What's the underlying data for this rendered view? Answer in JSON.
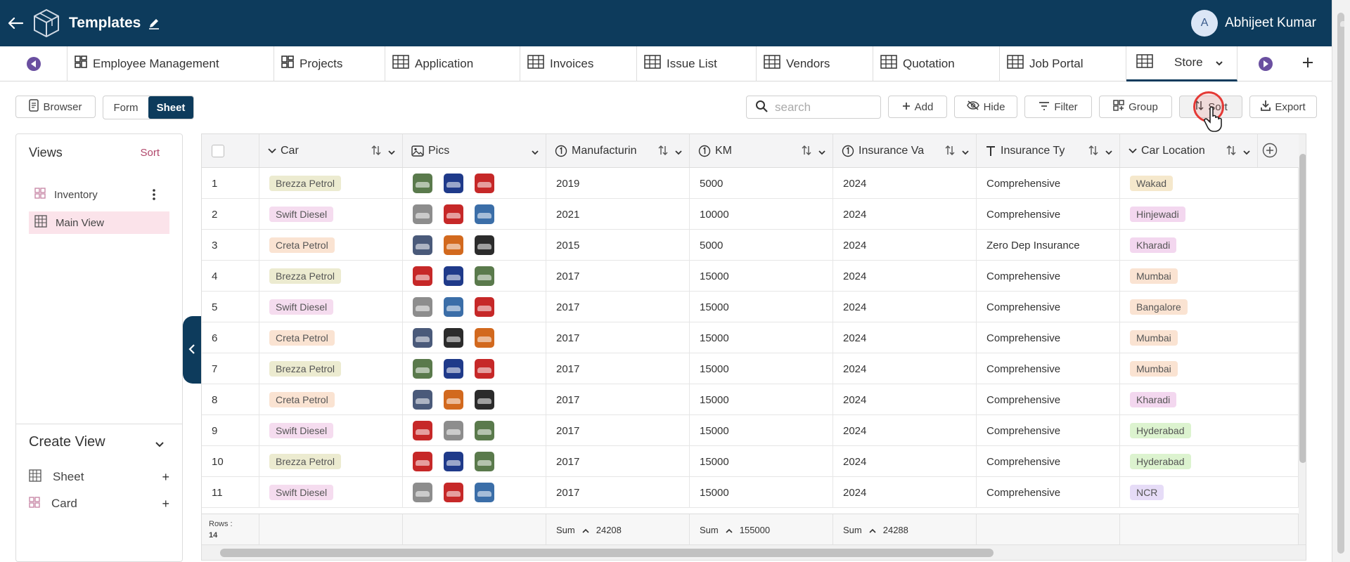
{
  "header": {
    "title": "Templates",
    "user": {
      "initial": "A",
      "name": "Abhijeet Kumar"
    }
  },
  "tabs": [
    {
      "label": "Employee Management",
      "icon": "dashboard-icon"
    },
    {
      "label": "Projects",
      "icon": "dashboard-icon"
    },
    {
      "label": "Application",
      "icon": "table-icon"
    },
    {
      "label": "Invoices",
      "icon": "table-icon"
    },
    {
      "label": "Issue List",
      "icon": "table-icon"
    },
    {
      "label": "Vendors",
      "icon": "table-icon"
    },
    {
      "label": "Quotation",
      "icon": "table-icon"
    },
    {
      "label": "Job Portal",
      "icon": "table-icon"
    },
    {
      "label": "Store",
      "icon": "table-icon",
      "active": true
    }
  ],
  "toolbar": {
    "browser": "Browser",
    "form": "Form",
    "sheet": "Sheet",
    "search_placeholder": "search",
    "add": "Add",
    "hide": "Hide",
    "filter": "Filter",
    "group": "Group",
    "sort": "Sort",
    "export": "Export"
  },
  "views": {
    "title": "Views",
    "sort": "Sort",
    "items": [
      {
        "label": "Inventory"
      },
      {
        "label": "Main View",
        "selected": true
      }
    ],
    "create_title": "Create View",
    "create_items": [
      {
        "label": "Sheet"
      },
      {
        "label": "Card"
      }
    ]
  },
  "columns": [
    "Car",
    "Pics",
    "Manufacturin",
    "KM",
    "Insurance Va",
    "Insurance Ty",
    "Car Location"
  ],
  "tag_colors": {
    "Brezza Petrol": "#ecebd0",
    "Swift Diesel": "#f5dcef",
    "Creta Petrol": "#fae3d2",
    "Wakad": "#f5e8cc",
    "Hinjewadi": "#f3d7ef",
    "Kharadi": "#f3d7ef",
    "Mumbai": "#fae3d2",
    "Bangalore": "#fae3d2",
    "Hyderabad": "#dcf3cf",
    "NCR": "#e6dcf7"
  },
  "rows": [
    {
      "id": "1",
      "car": "Brezza Petrol",
      "pics": [
        "#5a7a4c",
        "#1f3a8a",
        "#c62828"
      ],
      "year": "2019",
      "km": "5000",
      "ins_val": "2024",
      "ins_type": "Comprehensive",
      "location": "Wakad"
    },
    {
      "id": "2",
      "car": "Swift Diesel",
      "pics": [
        "#8d8d8d",
        "#c62828",
        "#3b6ea8"
      ],
      "year": "2021",
      "km": "10000",
      "ins_val": "2024",
      "ins_type": "Comprehensive",
      "location": "Hinjewadi"
    },
    {
      "id": "3",
      "car": "Creta Petrol",
      "pics": [
        "#4a5a7a",
        "#d2691e",
        "#2b2b2b"
      ],
      "year": "2015",
      "km": "5000",
      "ins_val": "2024",
      "ins_type": "Zero Dep Insurance",
      "location": "Kharadi"
    },
    {
      "id": "4",
      "car": "Brezza Petrol",
      "pics": [
        "#c62828",
        "#1f3a8a",
        "#5a7a4c"
      ],
      "year": "2017",
      "km": "15000",
      "ins_val": "2024",
      "ins_type": "Comprehensive",
      "location": "Mumbai"
    },
    {
      "id": "5",
      "car": "Swift Diesel",
      "pics": [
        "#8d8d8d",
        "#3b6ea8",
        "#c62828"
      ],
      "year": "2017",
      "km": "15000",
      "ins_val": "2024",
      "ins_type": "Comprehensive",
      "location": "Bangalore"
    },
    {
      "id": "6",
      "car": "Creta Petrol",
      "pics": [
        "#4a5a7a",
        "#2b2b2b",
        "#d2691e"
      ],
      "year": "2017",
      "km": "15000",
      "ins_val": "2024",
      "ins_type": "Comprehensive",
      "location": "Mumbai"
    },
    {
      "id": "7",
      "car": "Brezza Petrol",
      "pics": [
        "#5a7a4c",
        "#1f3a8a",
        "#c62828"
      ],
      "year": "2017",
      "km": "15000",
      "ins_val": "2024",
      "ins_type": "Comprehensive",
      "location": "Mumbai"
    },
    {
      "id": "8",
      "car": "Creta Petrol",
      "pics": [
        "#4a5a7a",
        "#d2691e",
        "#2b2b2b"
      ],
      "year": "2017",
      "km": "15000",
      "ins_val": "2024",
      "ins_type": "Comprehensive",
      "location": "Kharadi"
    },
    {
      "id": "9",
      "car": "Swift Diesel",
      "pics": [
        "#c62828",
        "#8d8d8d",
        "#5a7a4c"
      ],
      "year": "2017",
      "km": "15000",
      "ins_val": "2024",
      "ins_type": "Comprehensive",
      "location": "Hyderabad"
    },
    {
      "id": "10",
      "car": "Brezza Petrol",
      "pics": [
        "#c62828",
        "#1f3a8a",
        "#5a7a4c"
      ],
      "year": "2017",
      "km": "15000",
      "ins_val": "2024",
      "ins_type": "Comprehensive",
      "location": "Hyderabad"
    },
    {
      "id": "11",
      "car": "Swift Diesel",
      "pics": [
        "#8d8d8d",
        "#c62828",
        "#3b6ea8"
      ],
      "year": "2017",
      "km": "15000",
      "ins_val": "2024",
      "ins_type": "Comprehensive",
      "location": "NCR"
    }
  ],
  "footer": {
    "rows_label": "Rows :",
    "rows_count": "14",
    "sum_label": "Sum",
    "sum_manufacturing": "24208",
    "sum_km": "155000",
    "sum_insurance": "24288"
  }
}
